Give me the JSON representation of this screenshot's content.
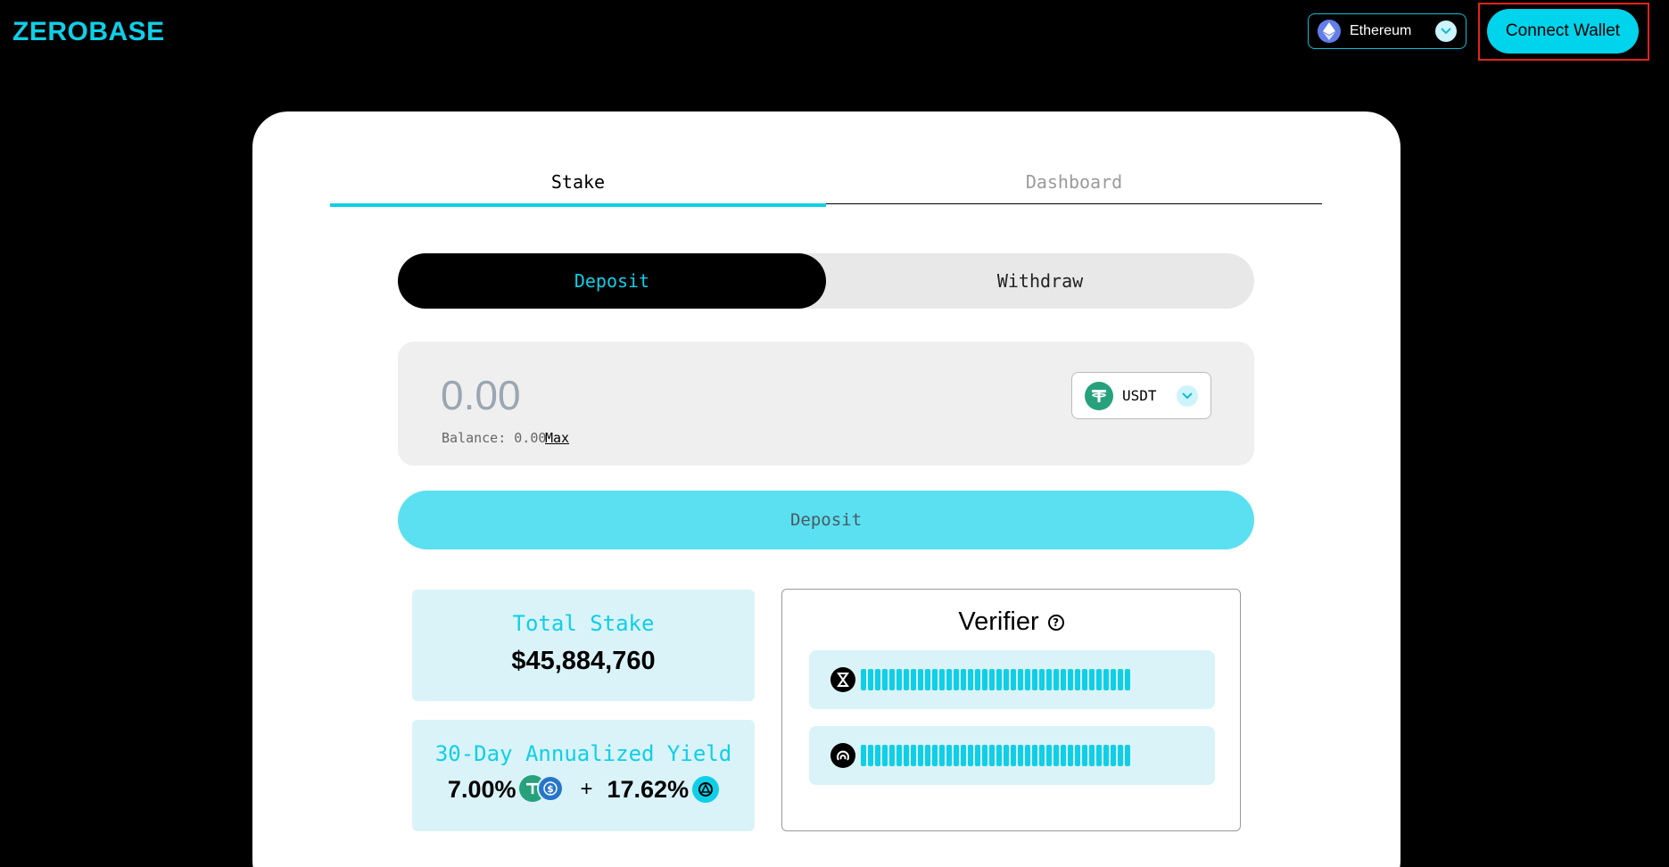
{
  "header": {
    "logo_text": "ZEROBASE",
    "network": {
      "label": "Ethereum",
      "icon": "ethereum-icon"
    },
    "connect_wallet_label": "Connect Wallet"
  },
  "tabs": [
    {
      "label": "Stake",
      "active": true
    },
    {
      "label": "Dashboard",
      "active": false
    }
  ],
  "mode_toggle": {
    "deposit_label": "Deposit",
    "withdraw_label": "Withdraw",
    "selected": "Deposit"
  },
  "amount": {
    "placeholder": "0.00",
    "value": "",
    "balance_text": "Balance: 0.00",
    "max_label": "Max",
    "token": {
      "symbol": "USDT",
      "icon": "usdt-icon"
    }
  },
  "deposit_button_label": "Deposit",
  "stats": {
    "total_stake": {
      "title": "Total Stake",
      "value": "$45,884,760"
    },
    "yield": {
      "title": "30-Day Annualized Yield",
      "base_value": "7.00%",
      "plus": "+",
      "bonus_value": "17.62%",
      "base_icons": [
        "usdt-icon",
        "usdc-icon"
      ],
      "bonus_icon": "zerobase-token-icon"
    }
  },
  "verifier": {
    "title": "Verifier",
    "help_icon": "question-circle-icon",
    "rows": [
      {
        "icon": "verifier-hourglass-icon"
      },
      {
        "icon": "verifier-swirl-icon"
      }
    ]
  },
  "colors": {
    "accent": "#0fcfe8",
    "highlight_border": "#e5231b",
    "usdt": "#26a17b",
    "usdc": "#2775ca",
    "eth": "#627eea"
  }
}
